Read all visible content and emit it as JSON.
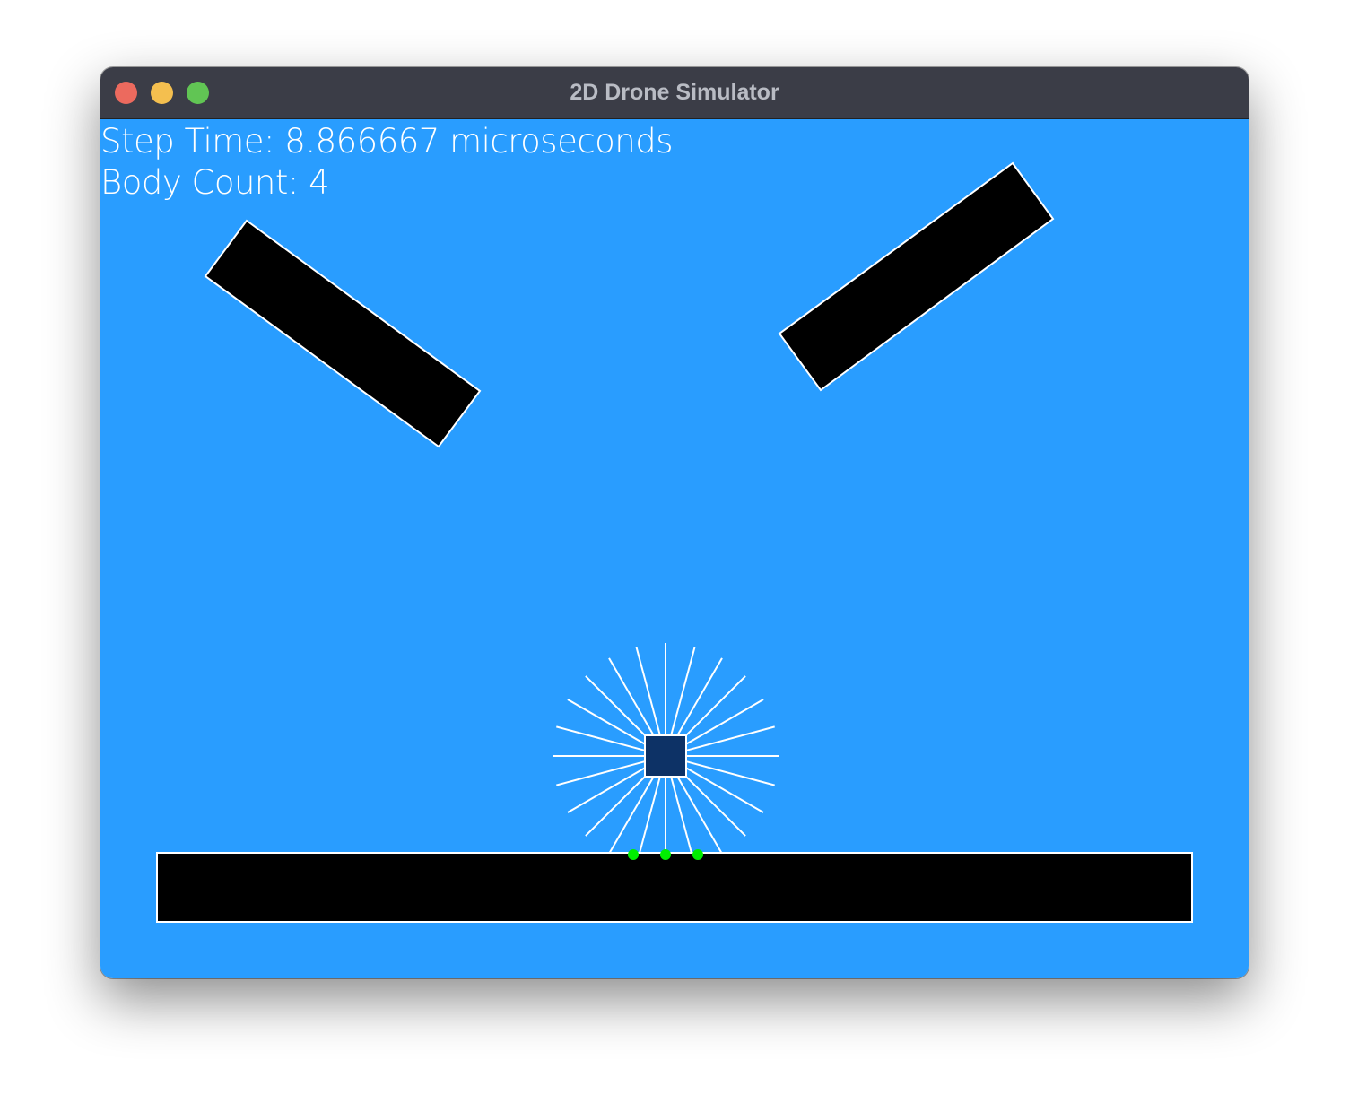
{
  "window": {
    "title": "2D Drone Simulator"
  },
  "hud": {
    "step_time": "Step Time: 8.866667 microseconds",
    "body_count": "Body Count: 4"
  },
  "colors": {
    "sky": "#299dff",
    "obstacle": "#000000",
    "outline": "#ffffff",
    "drone": "#0d3266",
    "contact": "#00ee00",
    "ray": "#ffffff",
    "close_button": "#ec6a5e",
    "minimize_button": "#f4bf4f",
    "maximize_button": "#61c554"
  },
  "icons": {
    "close": "close-icon",
    "minimize": "minimize-icon",
    "maximize": "maximize-icon"
  }
}
